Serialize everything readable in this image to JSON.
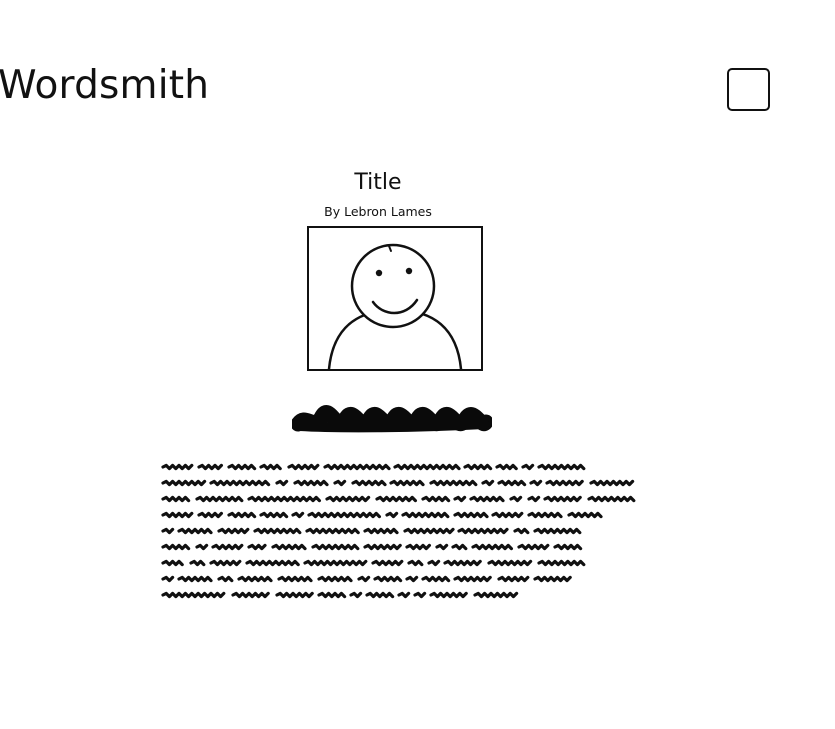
{
  "header": {
    "brand": "Wordsmith",
    "menu_icon": "empty-square-icon"
  },
  "article": {
    "title": "Title",
    "byline": "By Lebron Lames",
    "image_icon": "person-smiley-placeholder-icon",
    "heading_icon": "scribble-heading-placeholder",
    "body_icon": "scribble-text-placeholder"
  }
}
